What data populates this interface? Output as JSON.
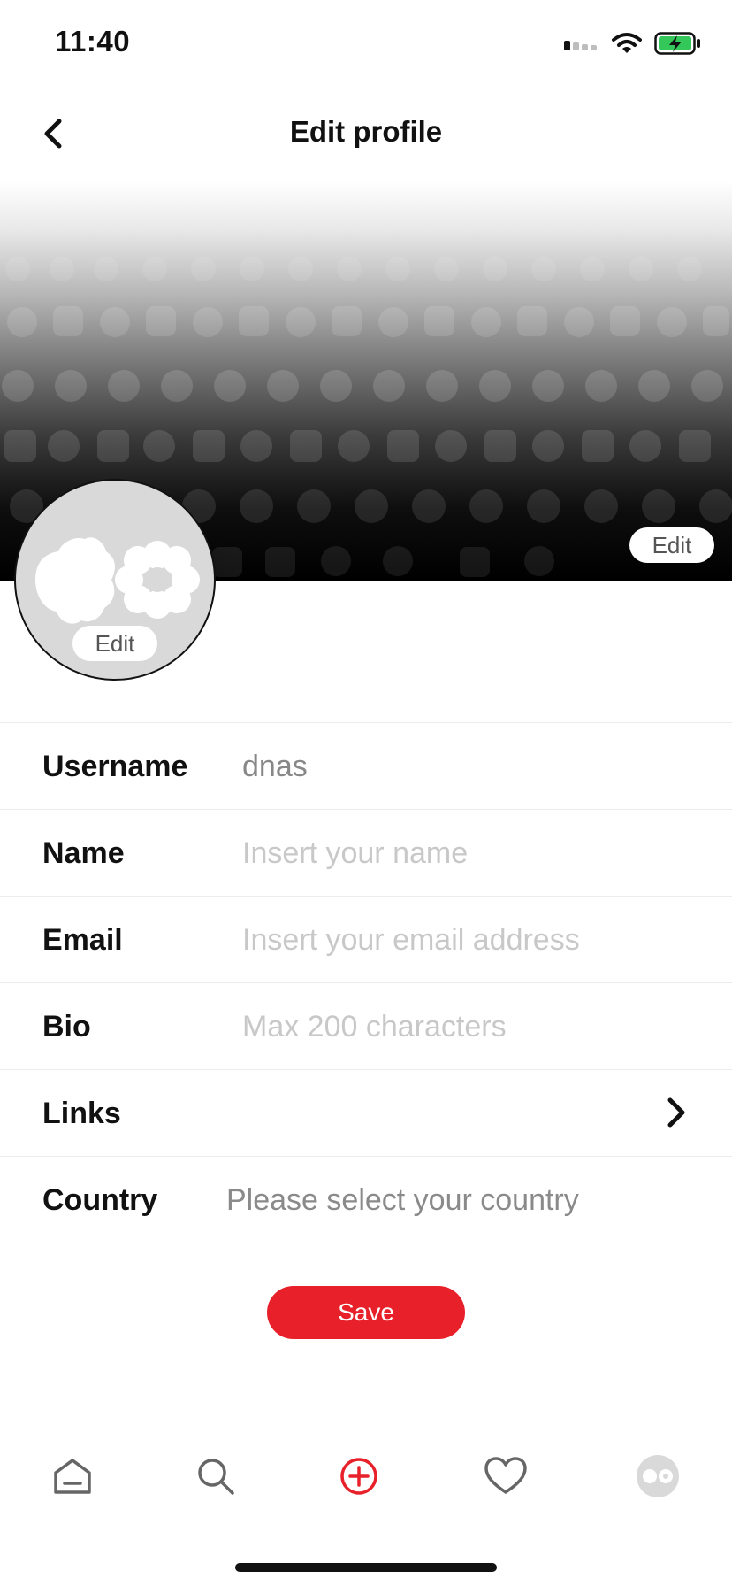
{
  "status_bar": {
    "time": "11:40"
  },
  "header": {
    "title": "Edit profile"
  },
  "banner": {
    "edit_label": "Edit"
  },
  "avatar": {
    "edit_label": "Edit"
  },
  "form": {
    "username": {
      "label": "Username",
      "value": "dnas"
    },
    "name": {
      "label": "Name",
      "placeholder": "Insert your name"
    },
    "email": {
      "label": "Email",
      "placeholder": "Insert your email address"
    },
    "bio": {
      "label": "Bio",
      "placeholder": "Max 200 characters"
    },
    "links": {
      "label": "Links"
    },
    "country": {
      "label": "Country",
      "placeholder": "Please select your country"
    }
  },
  "actions": {
    "save_label": "Save"
  },
  "colors": {
    "accent": "#e8202a",
    "battery": "#34c759"
  },
  "tab_bar": {
    "items": [
      "home-icon",
      "search-icon",
      "add-icon",
      "heart-icon",
      "profile-avatar-icon"
    ]
  }
}
